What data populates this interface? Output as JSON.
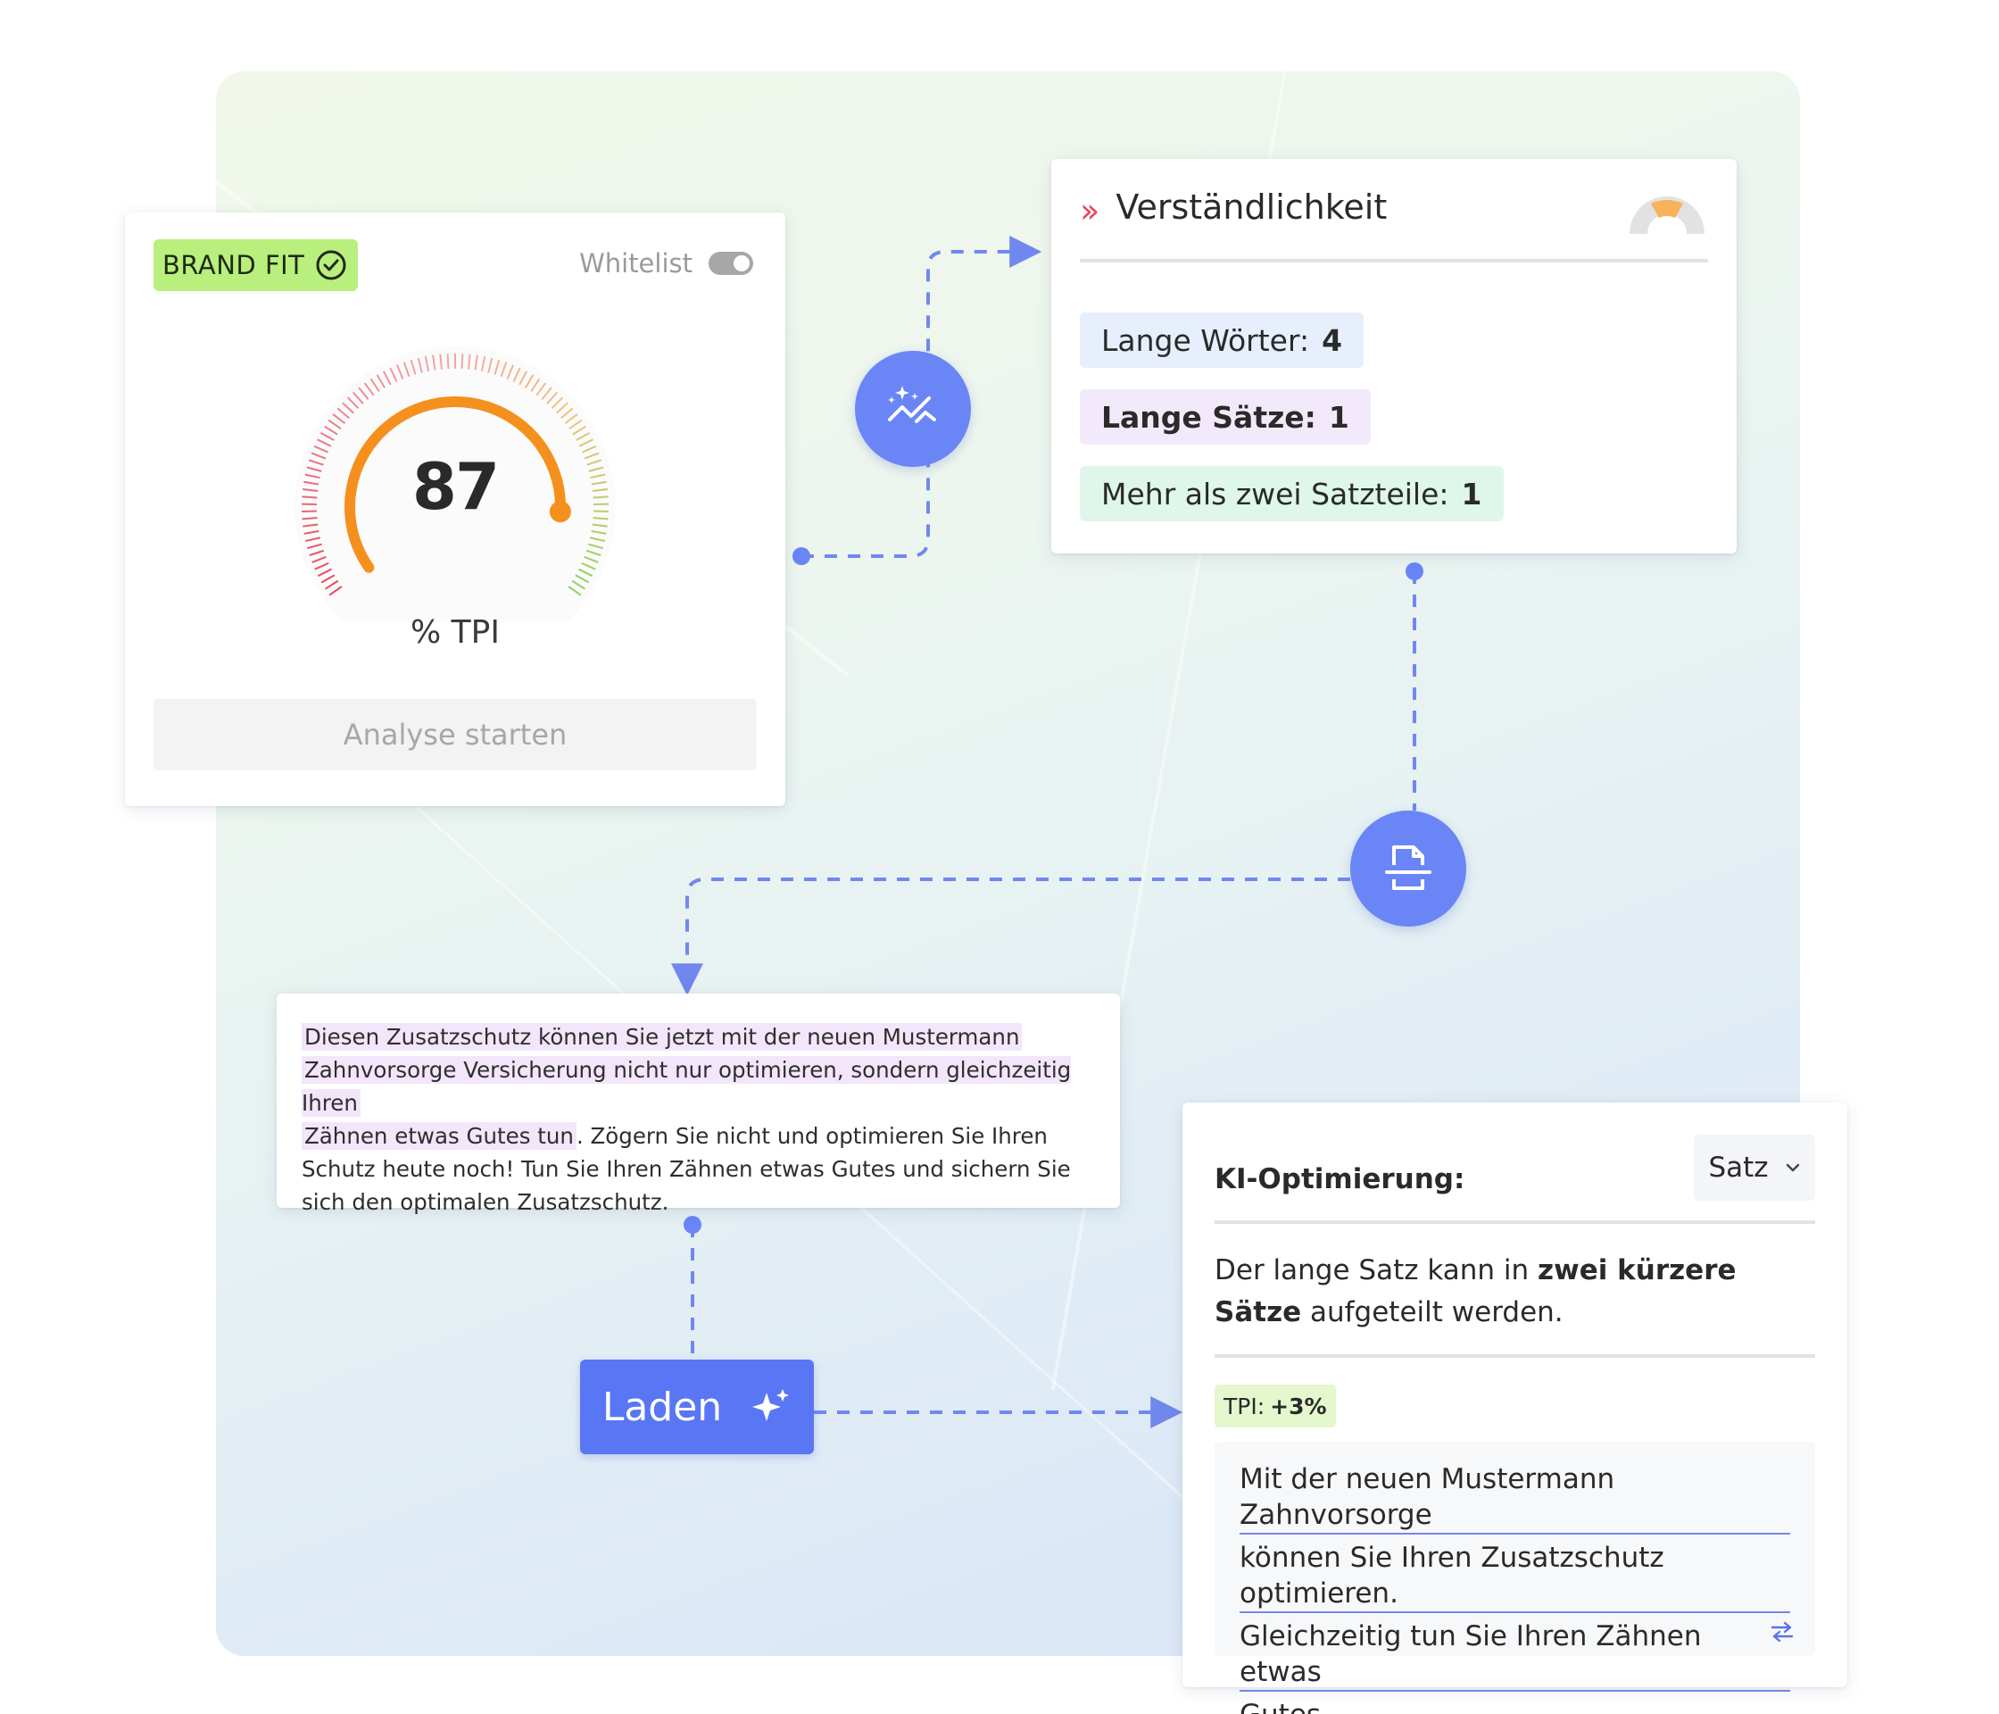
{
  "brand_card": {
    "badge_label": "BRAND FIT",
    "whitelist_label": "Whitelist",
    "whitelist_on": false,
    "score": "87",
    "score_value": 87,
    "unit_label": "% TPI",
    "analyse_button": "Analyse starten"
  },
  "understand_card": {
    "title": "Verständlichkeit",
    "stats": [
      {
        "label": "Lange Wörter:",
        "value": "4",
        "bg": "#e6effb"
      },
      {
        "label": "Lange Sätze:",
        "value": "1",
        "bg": "#f2eafb"
      },
      {
        "label": "Mehr als zwei Satzteile:",
        "value": "1",
        "bg": "#dff7ea"
      }
    ]
  },
  "text_card": {
    "highlighted_1": "Diesen Zusatzschutz können Sie jetzt mit der neuen Mustermann",
    "highlighted_2": "Zahnvorsorge Versicherung nicht nur optimieren, sondern gleichzeitig Ihren",
    "highlighted_3": "Zähnen etwas Gutes tun",
    "rest": ". Zögern Sie nicht und optimieren Sie Ihren Schutz heute noch! Tun Sie Ihren Zähnen etwas Gutes und sichern Sie sich den optimalen Zusatzschutz."
  },
  "load_button": {
    "label": "Laden"
  },
  "ki_card": {
    "title": "KI-Optimierung:",
    "select_value": "Satz",
    "desc_pre": "Der lange Satz kann in ",
    "desc_bold": "zwei kürzere Sätze",
    "desc_post": " aufgeteilt werden.",
    "tpi_label": "TPI:",
    "tpi_value": "+3%",
    "result_lines": [
      "Mit der neuen Mustermann Zahnvorsorge",
      "können Sie Ihren Zusatzschutz optimieren.",
      "Gleichzeitig tun Sie Ihren Zähnen etwas",
      "Gutes."
    ]
  },
  "colors": {
    "accent": "#6a85f6",
    "connector": "#7088ee",
    "gauge_orange": "#f5901e"
  }
}
